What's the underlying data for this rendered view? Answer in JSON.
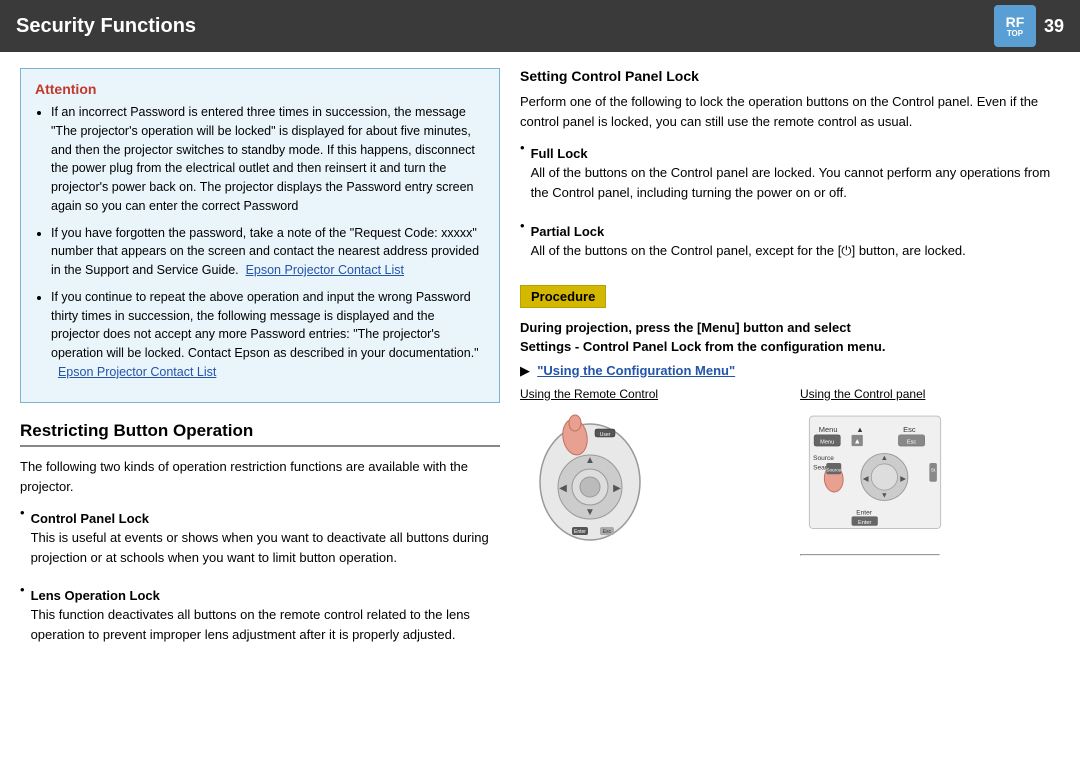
{
  "header": {
    "title": "Security Functions",
    "page_number": "39",
    "icon_letters": "RF",
    "icon_sub": "TOP"
  },
  "attention": {
    "title": "Attention",
    "bullets": [
      "If an incorrect Password is entered three times in succession, the message \"The projector's operation will be locked\" is displayed for about five minutes, and then the projector switches to standby mode. If this happens, disconnect the power plug from the electrical outlet and then reinsert it and turn the projector's power back on. The projector displays the Password entry screen again so you can enter the correct Password",
      "If you have forgotten the password, take a note of the \"Request Code: xxxxx\" number that appears on the screen and contact the nearest address provided in the Support and Service Guide.",
      "If you continue to repeat the above operation and input the wrong Password thirty times in succession, the following message is displayed and the projector does not accept any more Password entries: \"The projector's operation will be locked. Contact Epson as described in your documentation.\""
    ],
    "link1_text": "Epson Projector Contact List",
    "link2_text": "Epson Projector Contact List"
  },
  "restricting": {
    "heading": "Restricting Button Operation",
    "body": "The following two kinds of operation restriction functions are available with the projector.",
    "items": [
      {
        "name": "Control Panel Lock",
        "desc": "This is useful at events or shows when you want to deactivate all buttons during projection or at schools when you want to limit button operation."
      },
      {
        "name": "Lens Operation Lock",
        "desc": "This function deactivates all buttons on the remote control related to the lens operation to prevent improper lens adjustment after it is properly adjusted."
      }
    ]
  },
  "setting": {
    "heading": "Setting  Control  Panel  Lock",
    "body": "Perform one of the following to lock the operation buttons on the Control panel. Even if the control panel is locked, you can still use the remote control as usual.",
    "full_lock": {
      "name": "Full Lock",
      "desc": "All of the buttons on the Control panel are locked. You cannot perform any operations from the Control panel, including turning the power on or off."
    },
    "partial_lock": {
      "name": "Partial Lock",
      "desc": "All of the buttons on the Control panel, except for the [⏻] button, are locked."
    }
  },
  "procedure": {
    "label": "Procedure",
    "instruction_line1": "During projection, press the [Menu] button and select",
    "instruction_line2": "Settings - Control Panel Lock from the configuration menu.",
    "config_link": "\"Using the Configuration Menu\"",
    "diagram_left_label": "Using the Remote Control",
    "diagram_right_label": "Using the Control panel"
  }
}
